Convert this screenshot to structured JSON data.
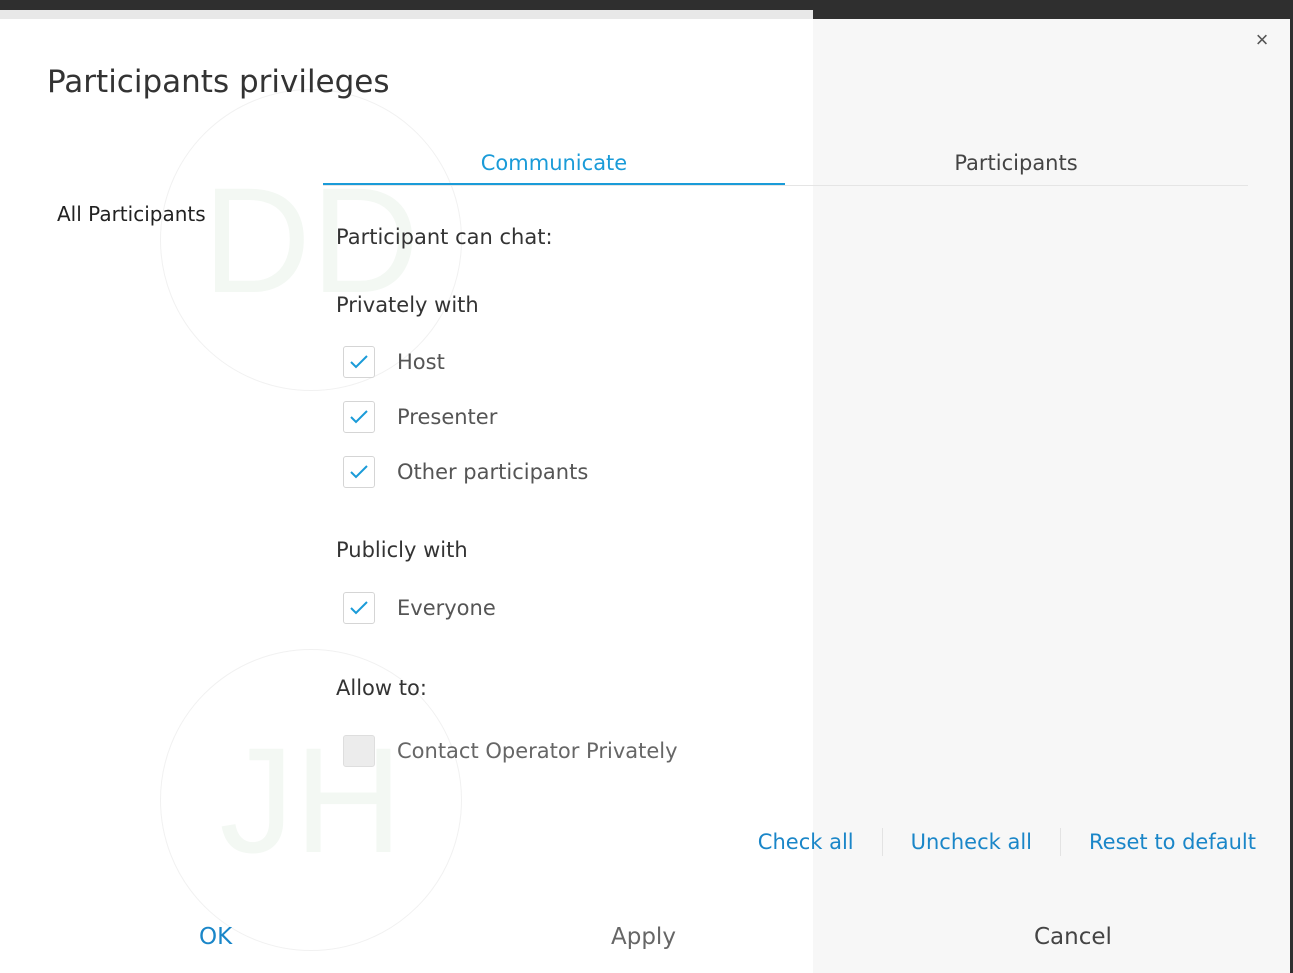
{
  "dialog": {
    "title": "Participants privileges",
    "close_symbol": "×"
  },
  "left_list": {
    "items": [
      {
        "label": "All Participants"
      }
    ]
  },
  "background_avatars": [
    "DD",
    "JH"
  ],
  "tabs": [
    {
      "label": "Communicate",
      "active": true
    },
    {
      "label": "Participants",
      "active": false
    }
  ],
  "communicate": {
    "heading": "Participant can chat:",
    "privately": {
      "label": "Privately with",
      "options": [
        {
          "label": "Host",
          "checked": true
        },
        {
          "label": "Presenter",
          "checked": true
        },
        {
          "label": "Other participants",
          "checked": true
        }
      ]
    },
    "publicly": {
      "label": "Publicly with",
      "options": [
        {
          "label": "Everyone",
          "checked": true
        }
      ]
    },
    "allow": {
      "label": "Allow to:",
      "options": [
        {
          "label": "Contact Operator Privately",
          "checked": false,
          "disabled": true
        }
      ]
    }
  },
  "links": {
    "check_all": "Check all",
    "uncheck_all": "Uncheck all",
    "reset": "Reset to default"
  },
  "footer": {
    "ok": "OK",
    "apply": "Apply",
    "cancel": "Cancel"
  },
  "colors": {
    "accent": "#1a9bd8",
    "link": "#1a86c8",
    "disabled_text": "#999999"
  },
  "icons": {
    "close": "close-icon",
    "check": "check-icon"
  }
}
